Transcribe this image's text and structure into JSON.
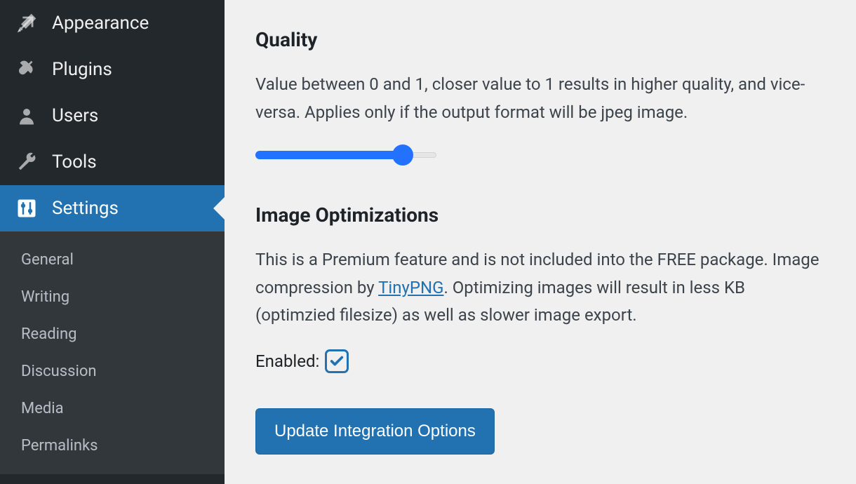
{
  "sidebar": {
    "items": [
      {
        "label": "Appearance",
        "icon": "appearance-icon"
      },
      {
        "label": "Plugins",
        "icon": "plugins-icon"
      },
      {
        "label": "Users",
        "icon": "users-icon"
      },
      {
        "label": "Tools",
        "icon": "tools-icon"
      },
      {
        "label": "Settings",
        "icon": "settings-icon"
      }
    ],
    "submenu": [
      "General",
      "Writing",
      "Reading",
      "Discussion",
      "Media",
      "Permalinks"
    ]
  },
  "content": {
    "quality": {
      "title": "Quality",
      "desc": "Value between 0 and 1, closer value to 1 results in higher quality, and vice-versa. Applies only if the output format will be jpeg image.",
      "slider_value": 0.8
    },
    "imageopt": {
      "title": "Image Optimizations",
      "desc_pre": "This is a Premium feature and is not included into the FREE package. Image compression by ",
      "link": "TinyPNG",
      "desc_post": ". Optimizing images will result in less KB (optimzied filesize) as well as slower image export.",
      "enabled_label": "Enabled:",
      "enabled": true
    },
    "button": "Update Integration Options"
  }
}
